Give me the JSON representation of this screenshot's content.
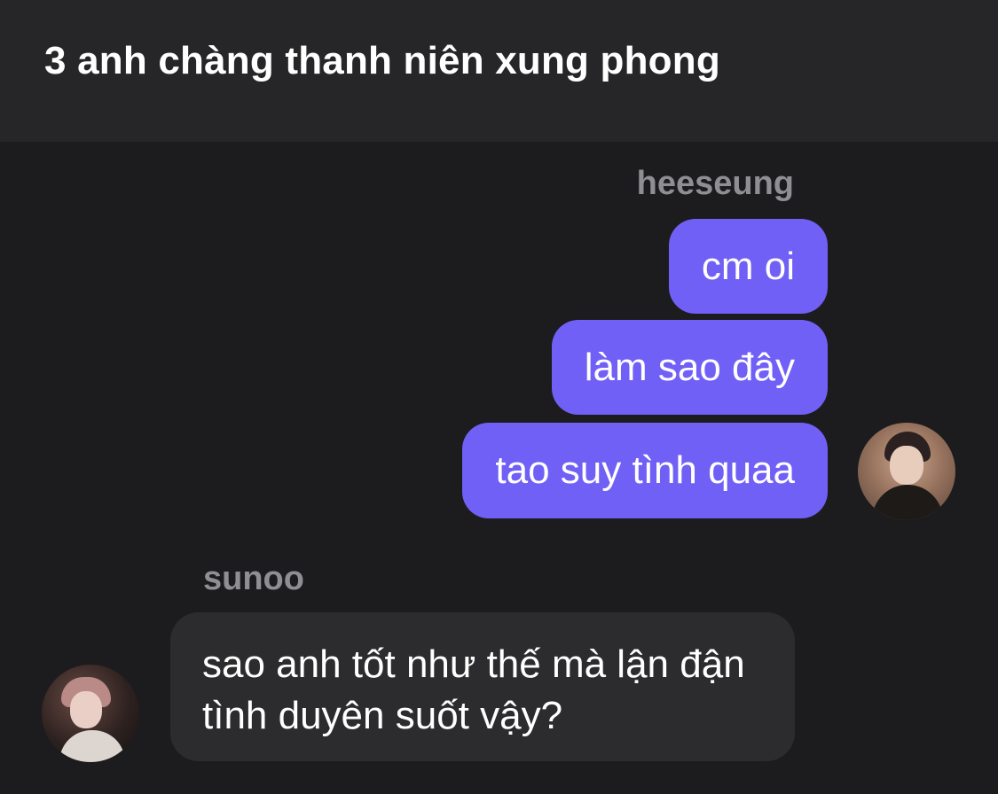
{
  "header": {
    "title": "3 anh chàng thanh niên xung phong"
  },
  "messages": {
    "group_outgoing": {
      "sender": "heeseung",
      "bubbles": [
        "cm oi",
        "làm sao đây",
        "tao suy tình quaa"
      ],
      "bubble_color": "#7160f5"
    },
    "group_incoming": {
      "sender": "sunoo",
      "text": "sao anh tốt như thế mà lận đận tình duyên suốt vậy?",
      "bubble_color": "#2c2c2e"
    }
  },
  "theme": {
    "background": "#1c1c1e",
    "header_background": "#262628",
    "sender_name_color": "#8e8e93"
  }
}
